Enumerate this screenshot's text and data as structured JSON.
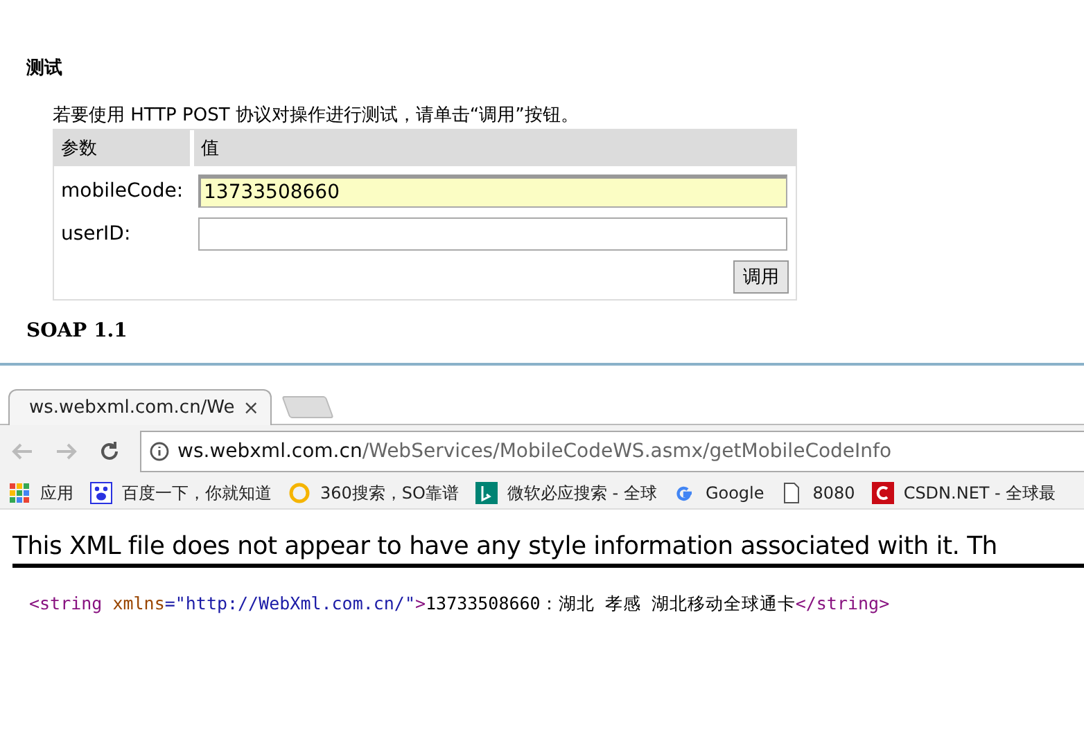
{
  "test_section": {
    "heading": "测试",
    "intro": "若要使用 HTTP POST 协议对操作进行测试，请单击“调用”按钮。",
    "columns": [
      "参数",
      "值"
    ],
    "params": [
      {
        "label": "mobileCode:",
        "value": "13733508660",
        "focused": true
      },
      {
        "label": "userID:",
        "focused": false
      }
    ],
    "invoke_button": "调用",
    "next_heading": "SOAP 1.1"
  },
  "browser": {
    "tab": {
      "title": "ws.webxml.com.cn/We",
      "close": "×"
    },
    "url": {
      "host": "ws.webxml.com.cn",
      "path": "/WebServices/MobileCodeWS.asmx/getMobileCodeInfo"
    },
    "bookmarks": [
      {
        "kind": "apps",
        "label": "应用"
      },
      {
        "kind": "paw",
        "label": "百度一下，你就知道"
      },
      {
        "kind": "ring",
        "label": "360搜索，SO靠谱"
      },
      {
        "kind": "bing",
        "label": "微软必应搜索 - 全球"
      },
      {
        "kind": "google",
        "label": "Google"
      },
      {
        "kind": "page",
        "label": "8080"
      },
      {
        "kind": "csdn",
        "label": "CSDN.NET - 全球最"
      }
    ],
    "xml_notice": "This XML file does not appear to have any style information associated with it. Th",
    "xml_line": [
      {
        "kind": "tag",
        "text": "<string"
      },
      {
        "kind": "attr",
        "text": " xmlns"
      },
      {
        "kind": "punct",
        "text": "=\""
      },
      {
        "kind": "value",
        "text": "http://WebXml.com.cn/"
      },
      {
        "kind": "punct",
        "text": "\""
      },
      {
        "kind": "tag",
        "text": ">"
      },
      {
        "kind": "text",
        "text": "13733508660：湖北 孝感 湖北移动全球通卡"
      },
      {
        "kind": "tag",
        "text": "</string>"
      }
    ]
  }
}
